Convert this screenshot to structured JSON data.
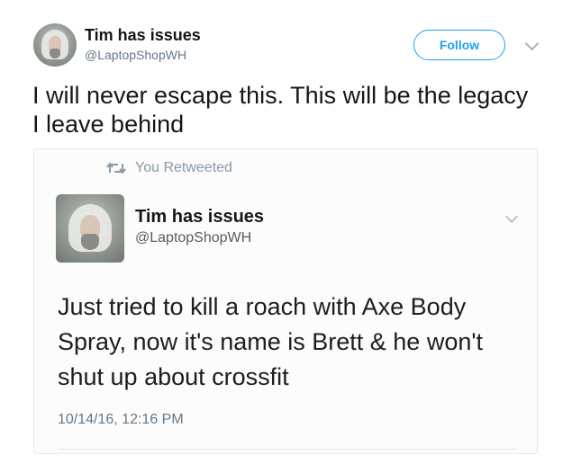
{
  "tweet": {
    "author_name": "Tim has issues",
    "author_handle": "@LaptopShopWH",
    "follow_label": "Follow",
    "text": "I will never escape this. This will be the legacy I leave behind"
  },
  "embedded": {
    "retweet_label": "You Retweeted",
    "author_name": "Tim has issues",
    "author_handle": "@LaptopShopWH",
    "text": "Just tried to kill a roach with Axe Body Spray, now it's name is Brett & he won't shut up about crossfit",
    "timestamp": "10/14/16, 12:16 PM"
  },
  "icons": {
    "more": "chevron-down-icon",
    "retweet": "retweet-icon"
  },
  "colors": {
    "accent": "#1da1f2",
    "secondary_text": "#657786"
  }
}
